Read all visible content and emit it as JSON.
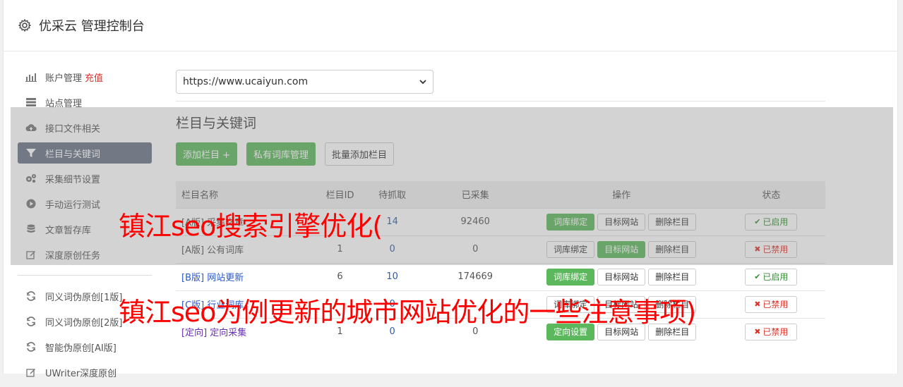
{
  "header": {
    "title": "优采云 管理控制台"
  },
  "sidebar": {
    "items": [
      {
        "label": "账户管理",
        "extra": "充值",
        "icon": "bar-chart-icon"
      },
      {
        "label": "站点管理",
        "icon": "server-icon"
      },
      {
        "label": "接口文件相关",
        "icon": "cloud-upload-icon"
      },
      {
        "label": "栏目与关键词",
        "icon": "filter-icon",
        "active": true
      },
      {
        "label": "采集细节设置",
        "icon": "cogs-icon"
      },
      {
        "label": "手动运行测试",
        "icon": "play-circle-icon"
      },
      {
        "label": "文章暂存库",
        "icon": "database-icon"
      },
      {
        "label": "深度原创任务",
        "icon": "edit-icon"
      }
    ],
    "items2": [
      {
        "label": "同义词伪原创[1版]",
        "icon": "refresh-icon"
      },
      {
        "label": "同义词伪原创[2版]",
        "icon": "refresh-icon"
      },
      {
        "label": "智能伪原创[AI版]",
        "icon": "refresh-icon"
      },
      {
        "label": "UWriter深度原创",
        "icon": "edit-icon"
      }
    ]
  },
  "main": {
    "site_select": "https://www.ucaiyun.com",
    "section_title": "栏目与关键词",
    "buttons": {
      "add_column": "添加栏目 +",
      "private_lib": "私有词库管理",
      "batch_add": "批量添加栏目"
    },
    "table": {
      "headers": [
        "栏目名称",
        "栏目ID",
        "待抓取",
        "已采集",
        "操作",
        "状态"
      ],
      "rows": [
        {
          "name": "[A版] 采集文章",
          "id": "",
          "pending": "14",
          "collected": "92460",
          "op1": "词库绑定",
          "op2": "目标网站",
          "op3": "删除栏目",
          "status": "已启用",
          "enabled": true
        },
        {
          "name": "[A版] 公有词库",
          "id": "1",
          "pending": "0",
          "collected": "0",
          "op1": "词库绑定",
          "op2": "目标网站",
          "op3": "删除栏目",
          "status": "已禁用",
          "enabled": false
        },
        {
          "name": "[B版] 网站更新",
          "id": "6",
          "pending": "10",
          "collected": "174669",
          "op1": "词库绑定",
          "op2": "目标网站",
          "op3": "删除栏目",
          "status": "已启用",
          "enabled": true
        },
        {
          "name": "[C版] 行业词库",
          "id": "",
          "pending": "0",
          "collected": "",
          "op1": "词库绑定",
          "op2": "目标网站",
          "op3": "删除栏目",
          "status": "已禁用",
          "enabled": false
        },
        {
          "name": "[定向] 定向采集",
          "id": "1",
          "pending": "0",
          "collected": "0",
          "op1": "定向设置",
          "op2": "目标网站",
          "op3": "删除栏目",
          "status": "已禁用",
          "enabled": false
        }
      ]
    }
  },
  "watermark": {
    "line1": "镇江seo搜索引擎优化(",
    "line2": "镇江seo为例更新的城市网站优化的一些注意事项)"
  },
  "colors": {
    "accent_green": "#5cb85c",
    "active_nav": "#6b7688",
    "danger": "#d9332a",
    "watermark": "#ff0000"
  }
}
